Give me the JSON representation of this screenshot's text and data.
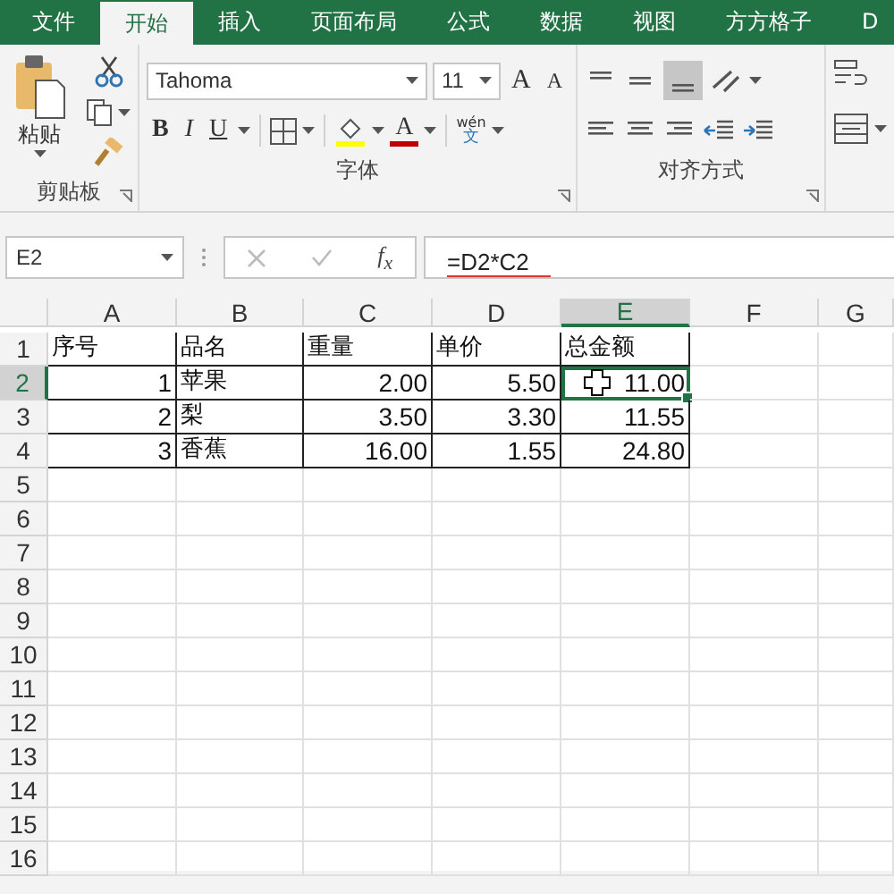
{
  "tabs": [
    {
      "label": "文件",
      "selected": false
    },
    {
      "label": "开始",
      "selected": true
    },
    {
      "label": "插入",
      "selected": false
    },
    {
      "label": "页面布局",
      "selected": false
    },
    {
      "label": "公式",
      "selected": false
    },
    {
      "label": "数据",
      "selected": false
    },
    {
      "label": "视图",
      "selected": false
    },
    {
      "label": "方方格子",
      "selected": false
    },
    {
      "label": "D",
      "selected": false
    }
  ],
  "ribbon": {
    "clipboard": {
      "paste_label": "粘贴",
      "group_label": "剪贴板"
    },
    "font": {
      "name": "Tahoma",
      "size": "11",
      "grow": "A",
      "shrink": "A",
      "bold": "B",
      "italic": "I",
      "underline": "U",
      "font_color": "A",
      "phonetic_top": "wén",
      "phonetic_bottom": "文",
      "group_label": "字体"
    },
    "alignment": {
      "group_label": "对齐方式",
      "bottom_align_selected": true
    }
  },
  "formula_bar": {
    "name_box": "E2",
    "function_label": "f$_{x}$",
    "formula": "=D2*C2"
  },
  "sheet": {
    "columns": [
      {
        "label": "A",
        "selected": false
      },
      {
        "label": "B",
        "selected": false
      },
      {
        "label": "C",
        "selected": false
      },
      {
        "label": "D",
        "selected": false
      },
      {
        "label": "E",
        "selected": true
      },
      {
        "label": "F",
        "selected": false
      },
      {
        "label": "G",
        "selected": false
      }
    ],
    "rows": [
      {
        "header": "1",
        "selected": false,
        "cells": [
          {
            "text": "序号",
            "kind": "text",
            "selected": false
          },
          {
            "text": "品名",
            "kind": "text",
            "selected": false
          },
          {
            "text": "重量",
            "kind": "text",
            "selected": false
          },
          {
            "text": "单价",
            "kind": "text",
            "selected": false
          },
          {
            "text": "总金额",
            "kind": "text",
            "selected": false
          }
        ]
      },
      {
        "header": "2",
        "selected": true,
        "cells": [
          {
            "text": "1",
            "kind": "number",
            "selected": false
          },
          {
            "text": "苹果",
            "kind": "text",
            "selected": false
          },
          {
            "text": "2.00",
            "kind": "number",
            "selected": false
          },
          {
            "text": "5.50",
            "kind": "number",
            "selected": false
          },
          {
            "text": "11.00",
            "kind": "number",
            "selected": true
          }
        ]
      },
      {
        "header": "3",
        "selected": false,
        "cells": [
          {
            "text": "2",
            "kind": "number",
            "selected": false
          },
          {
            "text": "梨",
            "kind": "text",
            "selected": false
          },
          {
            "text": "3.50",
            "kind": "number",
            "selected": false
          },
          {
            "text": "3.30",
            "kind": "number",
            "selected": false
          },
          {
            "text": "11.55",
            "kind": "number",
            "selected": false
          }
        ]
      },
      {
        "header": "4",
        "selected": false,
        "cells": [
          {
            "text": "3",
            "kind": "number",
            "selected": false
          },
          {
            "text": "香蕉",
            "kind": "text",
            "selected": false
          },
          {
            "text": "16.00",
            "kind": "number",
            "selected": false
          },
          {
            "text": "1.55",
            "kind": "number",
            "selected": false
          },
          {
            "text": "24.80",
            "kind": "number",
            "selected": false
          }
        ]
      },
      {
        "header": "5",
        "selected": false,
        "cells": []
      },
      {
        "header": "6",
        "selected": false,
        "cells": []
      },
      {
        "header": "7",
        "selected": false,
        "cells": []
      },
      {
        "header": "8",
        "selected": false,
        "cells": []
      },
      {
        "header": "9",
        "selected": false,
        "cells": []
      },
      {
        "header": "10",
        "selected": false,
        "cells": []
      },
      {
        "header": "11",
        "selected": false,
        "cells": []
      },
      {
        "header": "12",
        "selected": false,
        "cells": []
      },
      {
        "header": "13",
        "selected": false,
        "cells": []
      },
      {
        "header": "14",
        "selected": false,
        "cells": []
      },
      {
        "header": "15",
        "selected": false,
        "cells": []
      },
      {
        "header": "16",
        "selected": false,
        "cells": []
      }
    ]
  }
}
